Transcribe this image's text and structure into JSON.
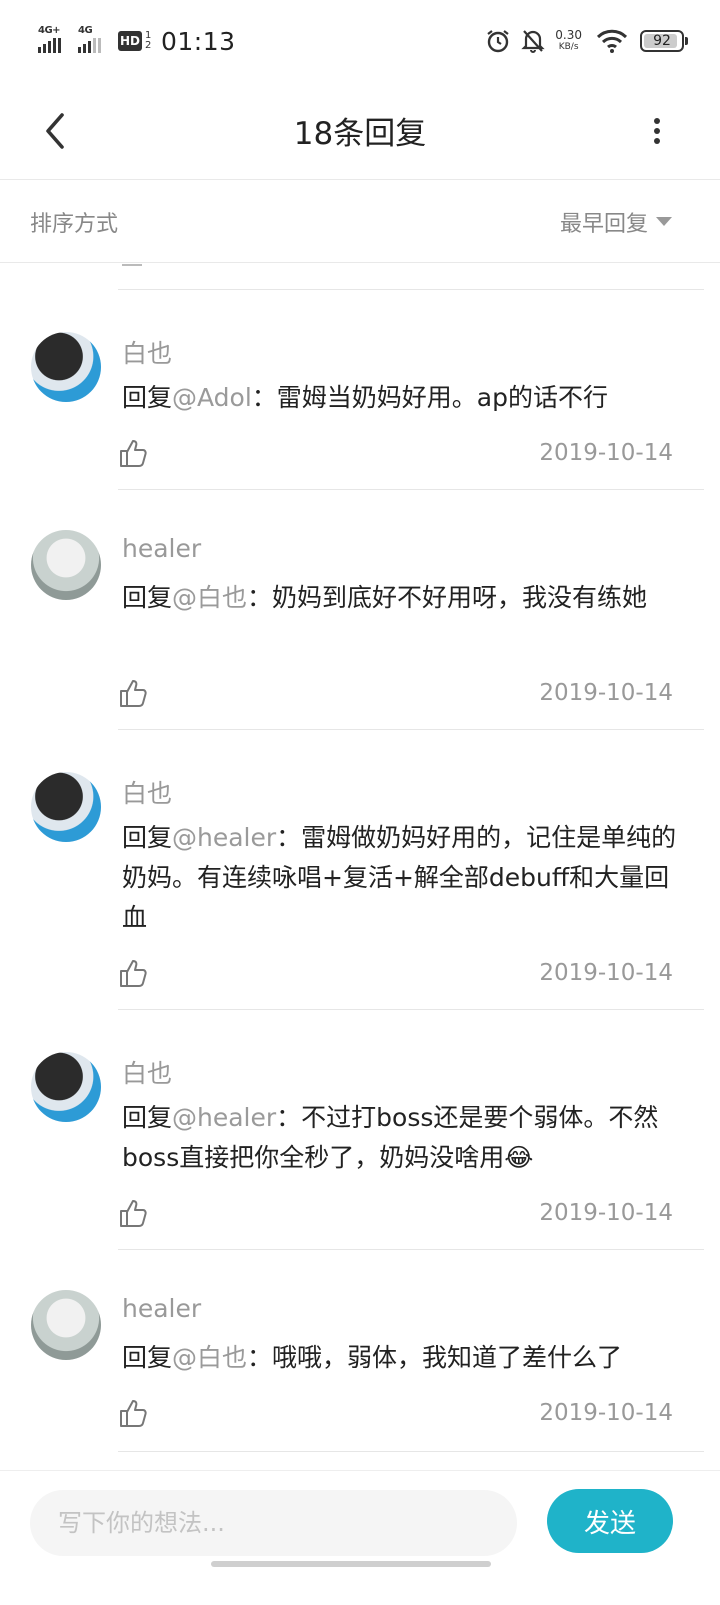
{
  "status_bar": {
    "network1": "4G+",
    "network2": "4G",
    "hd_label": "HD",
    "hd_sub": "1 2",
    "time": "01:13",
    "net_speed": "0.30",
    "net_speed_unit": "KB/s",
    "battery_level": 92,
    "battery_text": "92"
  },
  "header": {
    "title": "18条回复"
  },
  "sort": {
    "label": "排序方式",
    "value": "最早回复"
  },
  "comments": [
    {
      "author": "白也",
      "reply_prefix": "回复",
      "mention": "@Adol",
      "text": "：雷姆当奶妈好用。ap的话不行",
      "date": "2019-10-14",
      "avatar": "dark-hair-boy"
    },
    {
      "author": "healer",
      "reply_prefix": "回复",
      "mention": "@白也",
      "text": "：奶妈到底好不好用呀，我没有练她",
      "date": "2019-10-14",
      "avatar": "white-hair-character"
    },
    {
      "author": "白也",
      "reply_prefix": "回复",
      "mention": "@healer",
      "text": "：雷姆做奶妈好用的，记住是单纯的奶妈。有连续咏唱+复活+解全部debuff和大量回血",
      "date": "2019-10-14",
      "avatar": "dark-hair-boy"
    },
    {
      "author": "白也",
      "reply_prefix": "回复",
      "mention": "@healer",
      "text": "：不过打boss还是要个弱体。不然boss直接把你全秒了，奶妈没啥用😂",
      "date": "2019-10-14",
      "avatar": "dark-hair-boy"
    },
    {
      "author": "healer",
      "reply_prefix": "回复",
      "mention": "@白也",
      "text": "：哦哦，弱体，我知道了差什么了",
      "date": "2019-10-14",
      "avatar": "white-hair-character"
    }
  ],
  "composer": {
    "placeholder": "写下你的想法...",
    "send_label": "发送"
  },
  "colors": {
    "accent": "#1fb3c9",
    "muted": "#999999"
  },
  "icons": [
    "back-arrow-icon",
    "more-vertical-icon",
    "thumbs-up-icon",
    "caret-down-icon",
    "alarm-icon",
    "bell-off-icon",
    "wifi-icon",
    "battery-icon",
    "signal-icon"
  ]
}
